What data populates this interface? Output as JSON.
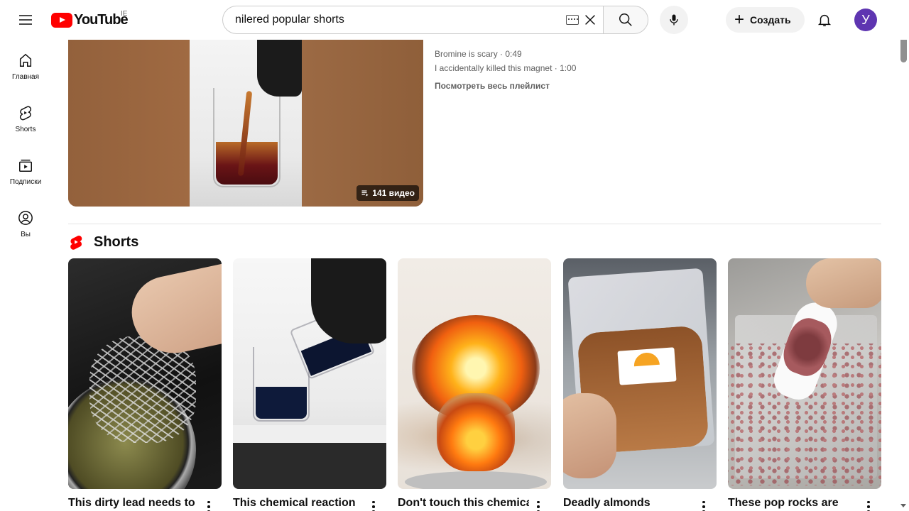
{
  "header": {
    "logo_text": "YouTube",
    "country_code": "IE",
    "search_value": "nilered popular shorts",
    "create_label": "Создать",
    "avatar_letter": "У"
  },
  "sidebar": {
    "items": [
      {
        "label": "Главная",
        "icon": "home-icon"
      },
      {
        "label": "Shorts",
        "icon": "shorts-icon"
      },
      {
        "label": "Подписки",
        "icon": "subscriptions-icon"
      },
      {
        "label": "Вы",
        "icon": "you-icon"
      }
    ]
  },
  "playlist": {
    "count_badge": "141 видео",
    "videos": [
      "Bromine is scary · 0:49",
      "I accidentally killed this magnet · 1:00"
    ],
    "view_all": "Посмотреть весь плейлист"
  },
  "shorts_section": {
    "title": "Shorts",
    "items": [
      {
        "title": "This dirty lead needs to"
      },
      {
        "title": "This chemical reaction"
      },
      {
        "title": "Don't touch this chemical"
      },
      {
        "title": "Deadly almonds"
      },
      {
        "title": "These pop rocks are"
      }
    ]
  },
  "colors": {
    "brand_red": "#ff0000",
    "avatar_bg": "#5e35b1"
  }
}
